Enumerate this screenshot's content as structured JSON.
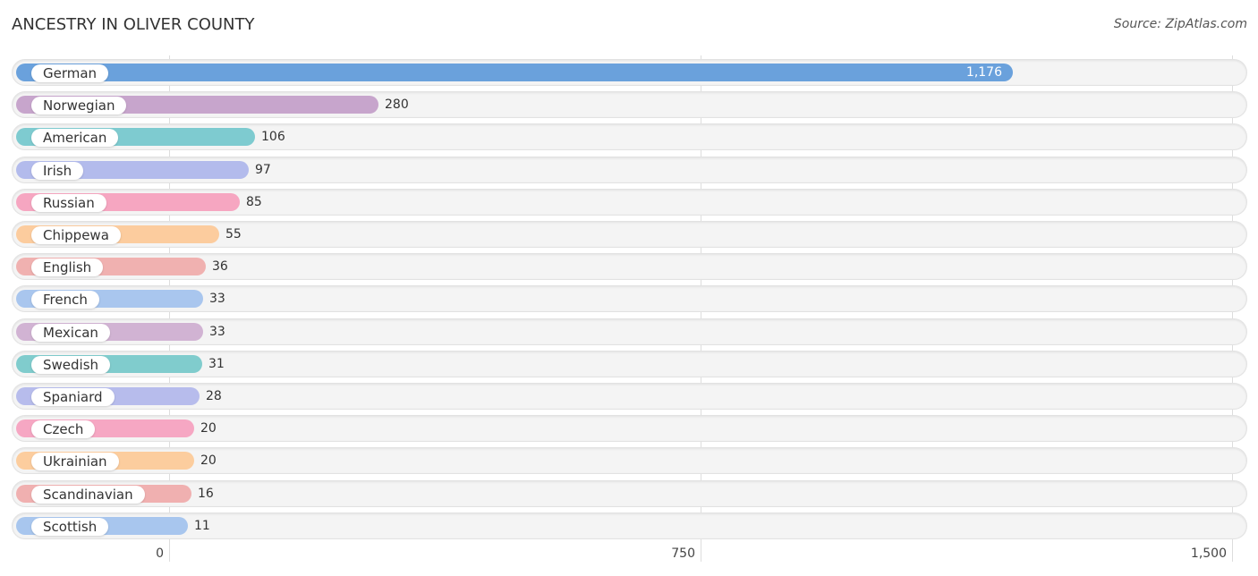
{
  "chart_data": {
    "type": "bar",
    "orientation": "horizontal",
    "title": "ANCESTRY IN OLIVER COUNTY",
    "source": "Source: ZipAtlas.com",
    "categories": [
      "German",
      "Norwegian",
      "American",
      "Irish",
      "Russian",
      "Chippewa",
      "English",
      "French",
      "Mexican",
      "Swedish",
      "Spaniard",
      "Czech",
      "Ukrainian",
      "Scandinavian",
      "Scottish"
    ],
    "values": [
      1176,
      280,
      106,
      97,
      85,
      55,
      36,
      33,
      33,
      31,
      28,
      20,
      20,
      16,
      11
    ],
    "value_labels": [
      "1,176",
      "280",
      "106",
      "97",
      "85",
      "55",
      "36",
      "33",
      "33",
      "31",
      "28",
      "20",
      "20",
      "16",
      "11"
    ],
    "colors": [
      "#6aa1dc",
      "#c7a5cc",
      "#7ecbd0",
      "#b3bbec",
      "#f6a6c1",
      "#fccc9e",
      "#f0b1b0",
      "#a9c6ee",
      "#d1b3d3",
      "#80cccd",
      "#b7bcec",
      "#f6a7c3",
      "#fccd9e",
      "#f0b0b0",
      "#a8c6ee"
    ],
    "xlim": [
      0,
      1500
    ],
    "xticks": [
      0,
      750,
      1500
    ],
    "xtick_labels": [
      "0",
      "750",
      "1,500"
    ],
    "xlabel": "",
    "ylabel": "",
    "grid": true,
    "legend": "none"
  }
}
